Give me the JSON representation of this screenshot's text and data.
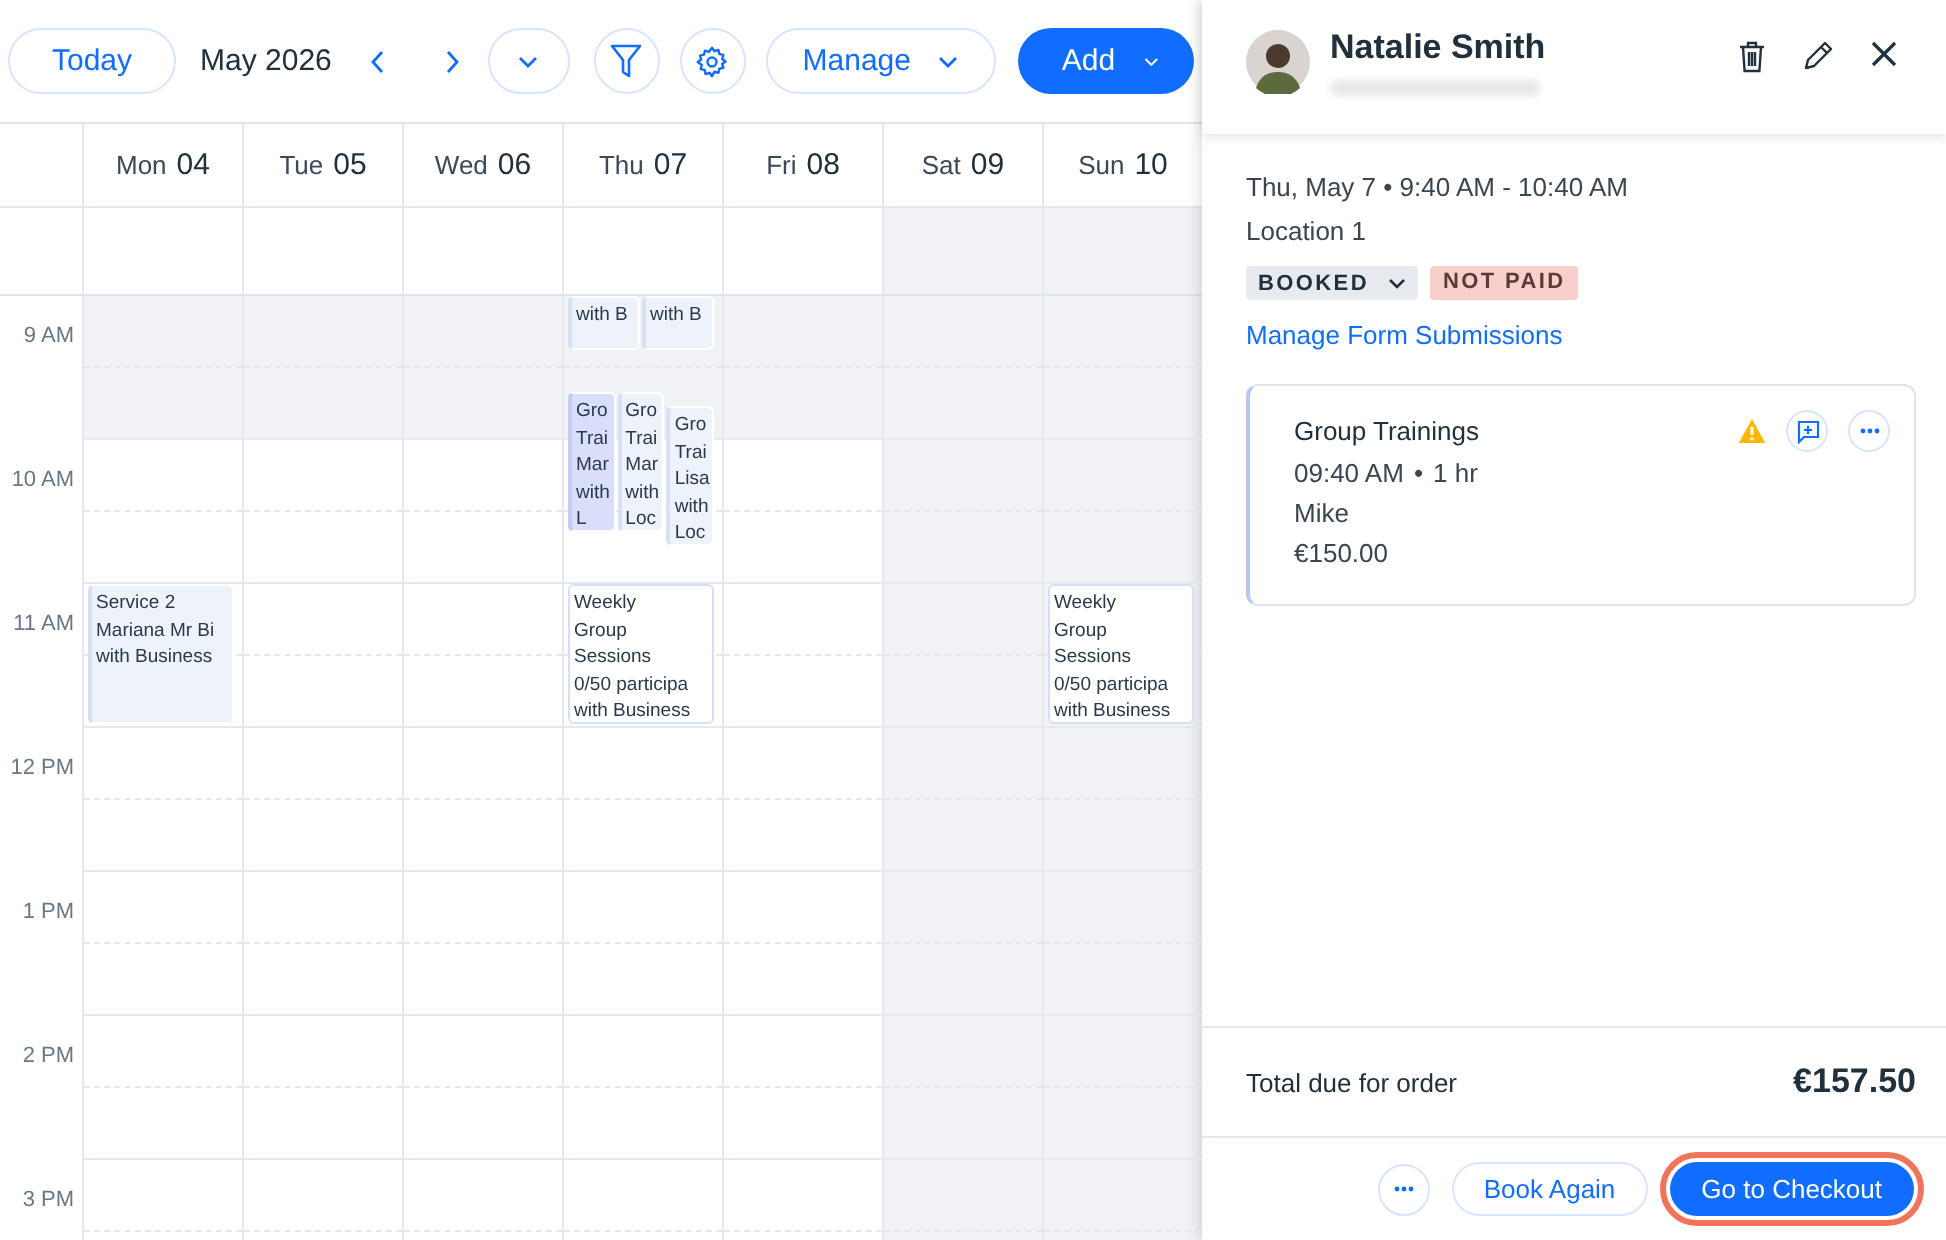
{
  "toolbar": {
    "today": "Today",
    "period": "May 2026",
    "manage": "Manage",
    "add": "Add"
  },
  "days": [
    {
      "weekday": "Mon",
      "date": "04",
      "weekend": false
    },
    {
      "weekday": "Tue",
      "date": "05",
      "weekend": false
    },
    {
      "weekday": "Wed",
      "date": "06",
      "weekend": false
    },
    {
      "weekday": "Thu",
      "date": "07",
      "weekend": false
    },
    {
      "weekday": "Fri",
      "date": "08",
      "weekend": false
    },
    {
      "weekday": "Sat",
      "date": "09",
      "weekend": true
    },
    {
      "weekday": "Sun",
      "date": "10",
      "weekend": true
    }
  ],
  "hours": [
    {
      "label": "9 AM",
      "shaded": true
    },
    {
      "label": "10 AM",
      "shaded": false
    },
    {
      "label": "11 AM",
      "shaded": false
    },
    {
      "label": "12 PM",
      "shaded": false
    },
    {
      "label": "1 PM",
      "shaded": false
    },
    {
      "label": "2 PM",
      "shaded": false
    },
    {
      "label": "3 PM",
      "shaded": false
    }
  ],
  "events": [
    {
      "kind": "appointment",
      "selected": false,
      "lines": [
        "with B"
      ]
    },
    {
      "kind": "appointment",
      "selected": false,
      "lines": [
        "with B"
      ]
    },
    {
      "kind": "appointment",
      "selected": true,
      "lines": [
        "Gro",
        "Trai",
        "Mar",
        "with",
        "L"
      ]
    },
    {
      "kind": "appointment",
      "selected": false,
      "lines": [
        "Gro",
        "Trai",
        "Mar",
        "with",
        "Loc"
      ]
    },
    {
      "kind": "appointment",
      "selected": false,
      "lines": [
        "Gro",
        "Trai",
        "Lisa",
        "with",
        "Loc"
      ]
    },
    {
      "kind": "appointment",
      "selected": false,
      "lines": [
        "Service 2",
        "Mariana Mr Bi",
        "with Business"
      ]
    },
    {
      "kind": "class",
      "selected": false,
      "lines": [
        "Weekly",
        "Group",
        "Sessions",
        "0/50 participa",
        "with Business"
      ]
    },
    {
      "kind": "class",
      "selected": false,
      "lines": [
        "Weekly",
        "Group",
        "Sessions",
        "0/50 participa",
        "with Business"
      ]
    }
  ],
  "booking": {
    "name": "Natalie Smith",
    "when": "Thu, May 7 • 9:40 AM - 10:40 AM",
    "location": "Location 1",
    "status": "BOOKED",
    "payment": "NOT PAID",
    "link": "Manage Form Submissions",
    "service": {
      "title": "Group Trainings",
      "warning": true,
      "time": "09:40 AM",
      "separator": "•",
      "duration": "1 hr",
      "staff": "Mike",
      "price": "€150.00"
    },
    "total_label": "Total due for order",
    "total": "€157.50",
    "book_again": "Book Again",
    "checkout": "Go to Checkout",
    "checkout_highlighted": true
  }
}
